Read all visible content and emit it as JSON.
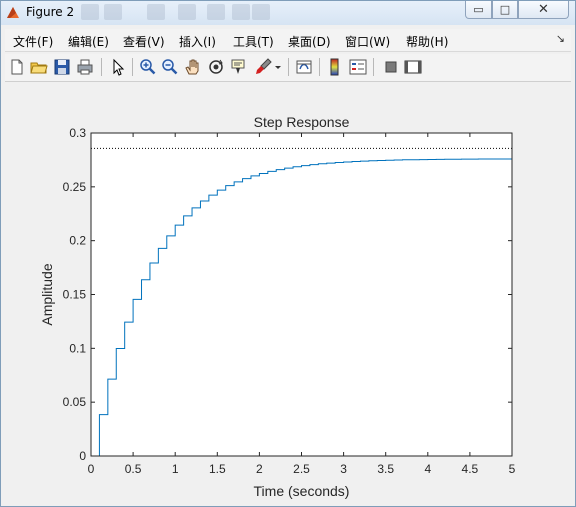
{
  "window": {
    "title": "Figure 2",
    "buttons": {
      "minimize": "▭",
      "maximize": "□",
      "close": "✕"
    }
  },
  "menu": {
    "items": [
      {
        "label": "文件(F)"
      },
      {
        "label": "编辑(E)"
      },
      {
        "label": "查看(V)"
      },
      {
        "label": "插入(I)"
      },
      {
        "label": "工具(T)"
      },
      {
        "label": "桌面(D)"
      },
      {
        "label": "窗口(W)"
      },
      {
        "label": "帮助(H)"
      }
    ],
    "overflow_arrow": "↘"
  },
  "toolbar": {
    "icons": [
      "new-figure-icon",
      "open-file-icon",
      "save-icon",
      "print-icon",
      "select-arrow-icon",
      "zoom-in-icon",
      "zoom-out-icon",
      "pan-hand-icon",
      "rotate-3d-icon",
      "data-cursor-icon",
      "brush-icon",
      "brush-dropdown-icon",
      "link-plot-icon",
      "colorbar-icon",
      "legend-icon",
      "hide-plot-tools-icon",
      "show-plot-tools-icon"
    ]
  },
  "colors": {
    "series": "#0072bd",
    "final_value_line": "#000000",
    "axes": "#262626"
  },
  "chart_data": {
    "type": "line",
    "title": "Step Response",
    "xlabel": "Time (seconds)",
    "ylabel": "Amplitude",
    "xlim": [
      0,
      5
    ],
    "ylim": [
      0,
      0.3
    ],
    "xticks": [
      "0",
      "0.5",
      "1",
      "1.5",
      "2",
      "2.5",
      "3",
      "3.5",
      "4",
      "4.5",
      "5"
    ],
    "yticks": [
      "0",
      "0.05",
      "0.1",
      "0.15",
      "0.2",
      "0.25",
      "0.3"
    ],
    "grid": false,
    "steady_state": 0.2857,
    "series": [
      {
        "style": "stairs",
        "x": [
          0,
          0.1,
          0.2,
          0.3,
          0.4,
          0.5,
          0.6,
          0.7,
          0.8,
          0.9,
          1.0,
          1.1,
          1.2,
          1.3,
          1.4,
          1.5,
          1.6,
          1.7,
          1.8,
          1.9,
          2.0,
          2.1,
          2.2,
          2.3,
          2.4,
          2.5,
          2.6,
          2.7,
          2.8,
          2.9,
          3.0,
          3.1,
          3.2,
          3.3,
          3.4,
          3.5,
          3.6,
          3.7,
          3.8,
          3.9,
          4.0,
          4.1,
          4.2,
          4.3,
          4.4,
          4.5,
          4.6,
          4.7,
          4.8,
          4.9,
          5.0
        ],
        "y": [
          0,
          0.0384,
          0.0714,
          0.0999,
          0.1244,
          0.1455,
          0.1637,
          0.1793,
          0.1928,
          0.2044,
          0.2144,
          0.223,
          0.2304,
          0.2368,
          0.2423,
          0.247,
          0.2511,
          0.2546,
          0.2576,
          0.2602,
          0.2624,
          0.2643,
          0.266,
          0.2674,
          0.2686,
          0.2697,
          0.2706,
          0.2714,
          0.272,
          0.2726,
          0.2731,
          0.2735,
          0.2739,
          0.2742,
          0.2745,
          0.2747,
          0.2749,
          0.2751,
          0.2752,
          0.2753,
          0.2754,
          0.2755,
          0.2756,
          0.2756,
          0.2757,
          0.2757,
          0.2758,
          0.2758,
          0.2758,
          0.2758,
          0.2758
        ]
      }
    ]
  }
}
